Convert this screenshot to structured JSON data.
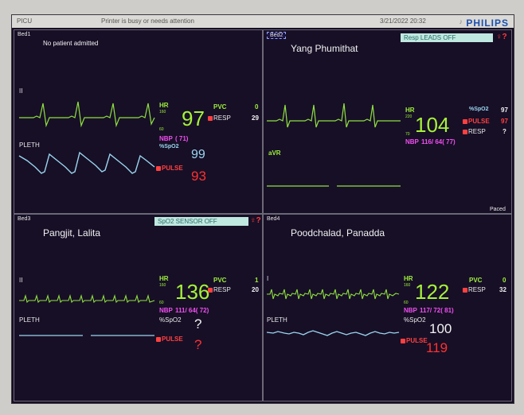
{
  "topbar": {
    "unit": "PICU",
    "message": "Printer is busy or needs attention",
    "datetime": "3/21/2022 20:32",
    "brand": "PHILIPS"
  },
  "colors": {
    "background": "#150e24",
    "hr": "#a6f23a",
    "spo2": "#9ad6ef",
    "nbp": "#f04ef0",
    "pulse": "#ff3030",
    "alarm_bg": "#bfe8e0"
  },
  "bed1": {
    "label": "Bed1",
    "name": "No patient admitted",
    "lead": "II",
    "hr_label": "HR",
    "hr_hi": "160",
    "hr_lo": "60",
    "hr": "97",
    "pvc_label": "PVC",
    "pvc": "0",
    "resp_label": "RESP",
    "resp": "29",
    "nbp_label": "NBP",
    "nbp": "( 71)",
    "spo2_label": "%SpO2",
    "spo2": "99",
    "pleth_label": "PLETH",
    "pulse_label": "PULSE",
    "pulse": "93"
  },
  "bed2": {
    "label": "Bed2",
    "name": "Yang Phumithat",
    "alarm": "Resp  LEADS OFF",
    "alarm_mark": "?",
    "hr_label": "HR",
    "hr_hi": "220",
    "hr_lo": "70",
    "hr": "104",
    "spo2_label": "%SpO2",
    "spo2": "97",
    "pulse_label": "PULSE",
    "pulse": "97",
    "resp_label": "RESP",
    "resp": "?",
    "nbp_label": "NBP",
    "nbp": "116/ 64( 77)",
    "lead2": "aVR",
    "paced": "Paced"
  },
  "bed3": {
    "label": "Bed3",
    "name": "Pangjit, Lalita",
    "alarm": "SpO2  SENSOR OFF",
    "alarm_mark": "?",
    "lead": "II",
    "hr_label": "HR",
    "hr_hi": "160",
    "hr_lo": "60",
    "hr": "136",
    "pvc_label": "PVC",
    "pvc": "1",
    "resp_label": "RESP",
    "resp": "20",
    "nbp_label": "NBP",
    "nbp": "111/ 64( 72)",
    "spo2_label": "%SpO2",
    "spo2": "?",
    "pleth_label": "PLETH",
    "pulse_label": "PULSE",
    "pulse": "?"
  },
  "bed4": {
    "label": "Bed4",
    "name": "Poodchalad, Panadda",
    "lead": "I",
    "hr_label": "HR",
    "hr_hi": "160",
    "hr_lo": "60",
    "hr": "122",
    "pvc_label": "PVC",
    "pvc": "0",
    "resp_label": "RESP",
    "resp": "32",
    "nbp_label": "NBP",
    "nbp": "117/ 72( 81)",
    "spo2_label": "%SpO2",
    "spo2": "100",
    "pleth_label": "PLETH",
    "pulse_label": "PULSE",
    "pulse": "119"
  }
}
